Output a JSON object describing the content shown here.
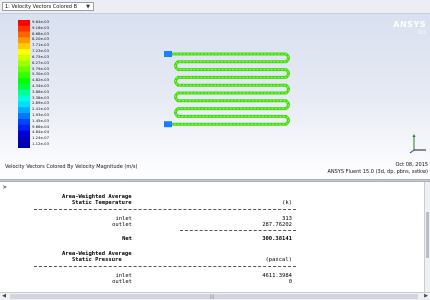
{
  "window_selector": {
    "value": "1: Velocity Vectors Colored B",
    "arrow": "▼"
  },
  "viewport": {
    "brand": "ANSYS",
    "brand_sub": "R15",
    "legend_labels": [
      "9.64e-03",
      "9.16e-03",
      "8.68e-03",
      "8.20e-03",
      "7.71e-03",
      "7.23e-03",
      "6.75e-03",
      "6.27e-03",
      "5.79e-03",
      "5.30e-03",
      "4.82e-03",
      "4.34e-03",
      "3.86e-03",
      "3.38e-03",
      "2.89e-03",
      "2.41e-03",
      "1.93e-03",
      "1.45e-03",
      "9.66e-04",
      "4.84e-04",
      "1.24e-07",
      "1.12e-03"
    ],
    "colorbar_colors": [
      "#ff0000",
      "#ff3300",
      "#ff6600",
      "#ff9900",
      "#ffcc00",
      "#ffff00",
      "#ccff00",
      "#99ff00",
      "#66ff00",
      "#33ff00",
      "#00ff00",
      "#00ff44",
      "#00ff99",
      "#00ffdd",
      "#00ddff",
      "#00aaff",
      "#0077ff",
      "#0044ff",
      "#0022ee",
      "#0000dd",
      "#0000bb",
      "#0000aa"
    ],
    "caption": "Velocity Vectors Colored By Velocity Magnitude (m/s)",
    "date": "Oct 08, 2015",
    "solver_info": "ANSYS Fluent 15.0 (3d, dp, pbns, sstkw)"
  },
  "console": {
    "prompt": ">",
    "temperature": {
      "header_line1": "Area-Weighted Average",
      "header_line2": "Static Temperature",
      "unit": "(k)",
      "rows": [
        {
          "name": "inlet",
          "value": "313"
        },
        {
          "name": "outlet",
          "value": "287.76202"
        }
      ],
      "net_label": "Net",
      "net_value": "300.38141"
    },
    "pressure": {
      "header_line1": "Area-Weighted Average",
      "header_line2": "Static Pressure",
      "unit": "(pascal)",
      "rows": [
        {
          "name": "inlet",
          "value": "4611.3984"
        },
        {
          "name": "outlet",
          "value": "0"
        }
      ]
    }
  },
  "hscroll": {
    "left_arrow": "◀",
    "right_arrow": "▶",
    "grip": "|||"
  }
}
